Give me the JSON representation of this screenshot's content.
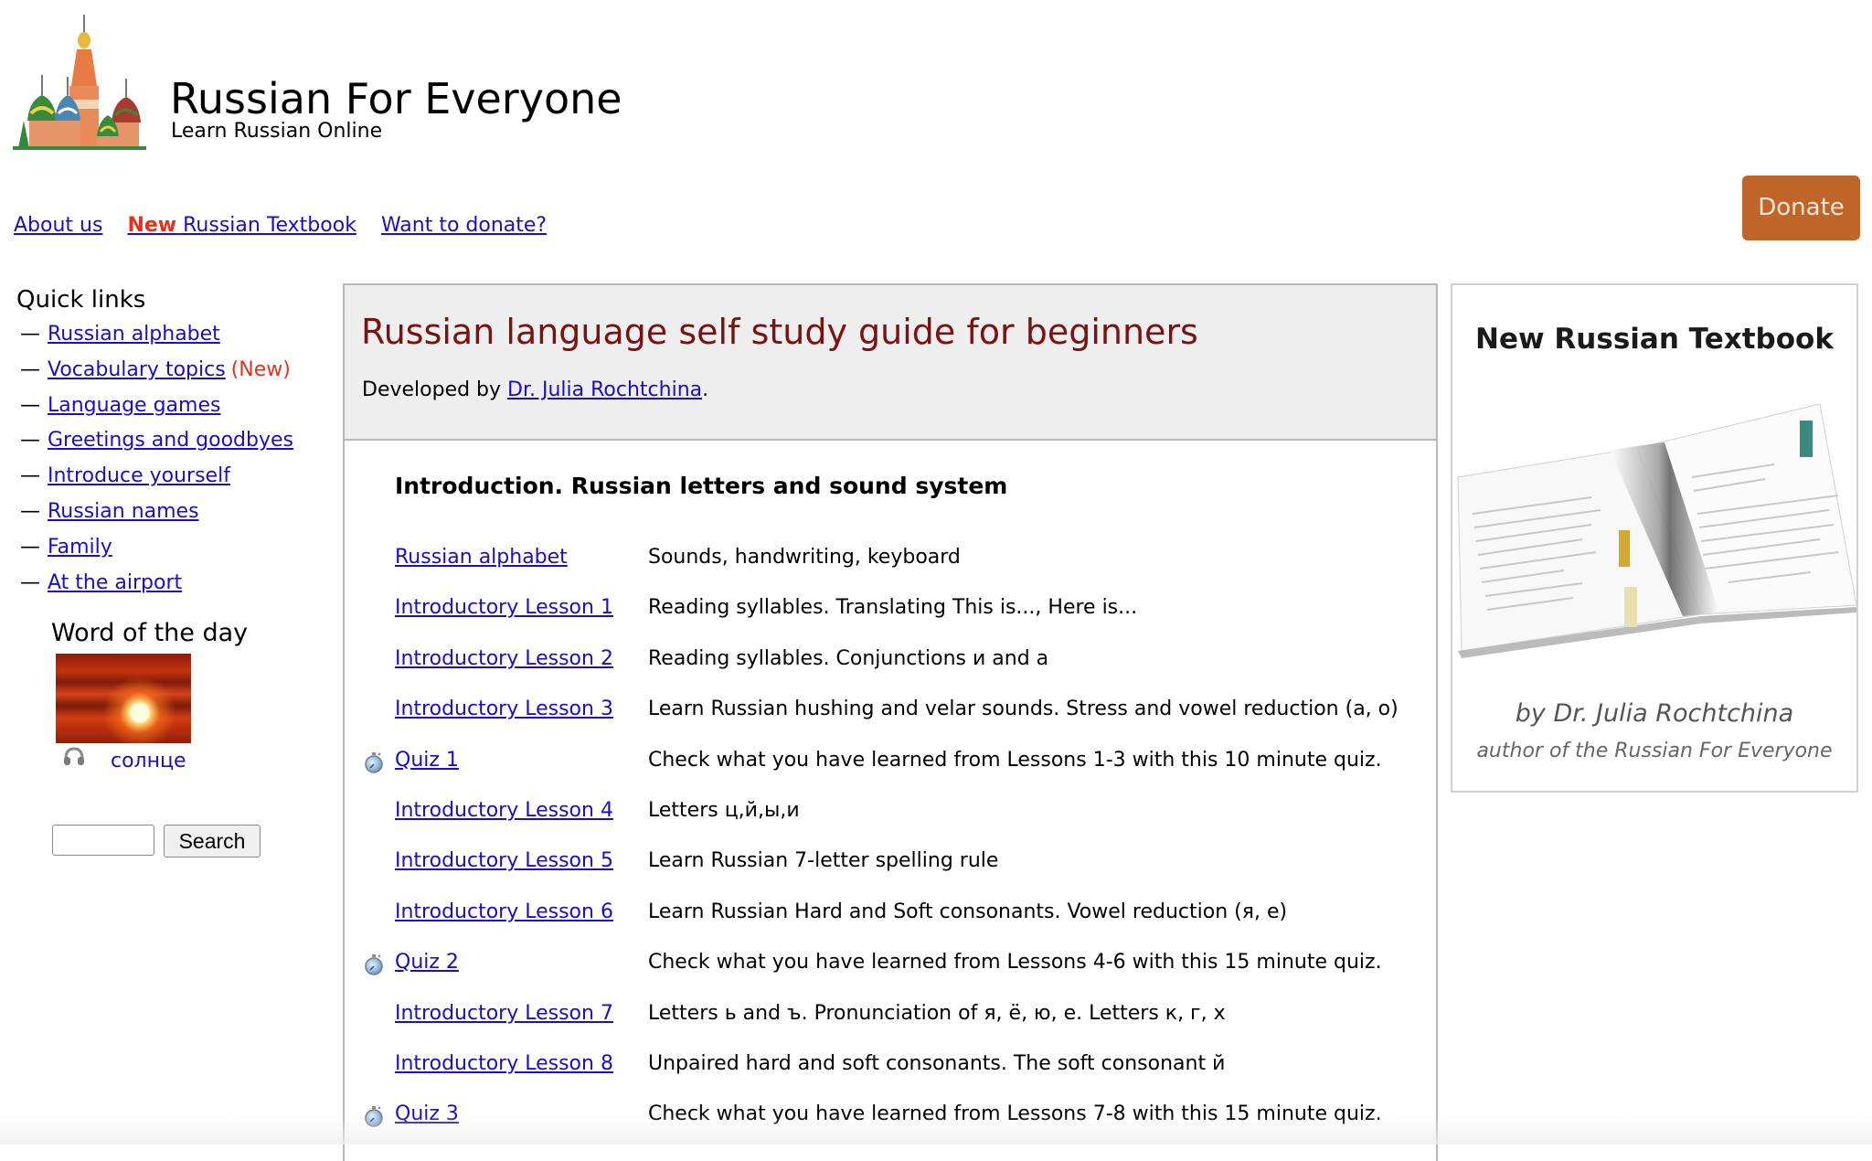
{
  "header": {
    "site_title": "Russian For Everyone",
    "site_subtitle": "Learn Russian Online",
    "logo_icon": "cathedral-logo-icon"
  },
  "nav": {
    "about": "About us",
    "textbook_new": "New",
    "textbook": " Russian Textbook",
    "donate_link": "Want to donate?",
    "donate_button": "Donate",
    "donate_color": "#c0652a",
    "new_color": "#e8301c"
  },
  "sidebar": {
    "quick_links_title": "Quick links",
    "dash": "—",
    "quick_links": [
      {
        "label": "Russian alphabet",
        "badge": ""
      },
      {
        "label": "Vocabulary topics",
        "badge": "(New)"
      },
      {
        "label": "Language games",
        "badge": ""
      },
      {
        "label": "Greetings and goodbyes",
        "badge": ""
      },
      {
        "label": "Introduce yourself",
        "badge": ""
      },
      {
        "label": "Russian names",
        "badge": ""
      },
      {
        "label": "Family",
        "badge": ""
      },
      {
        "label": "At the airport",
        "badge": ""
      }
    ],
    "word_of_day_title": "Word of the day",
    "word_of_day": "солнце",
    "word_image_icon": "sunset-image",
    "audio_icon": "headphones-icon",
    "search_value": "",
    "search_button": "Search"
  },
  "main": {
    "title": "Russian language self study guide for beginners",
    "title_color": "#7b1212",
    "developed_prefix": "Developed by ",
    "developer": "Dr. Julia Rochtchina",
    "developed_suffix": ".",
    "section_title": "Introduction. Russian letters and sound system",
    "rows": [
      {
        "link": "Russian alphabet",
        "desc": "Sounds, handwriting, keyboard",
        "quiz": false
      },
      {
        "link": "Introductory Lesson 1",
        "desc": "Reading syllables. Translating This is..., Here is...",
        "quiz": false
      },
      {
        "link": "Introductory Lesson 2",
        "desc": "Reading syllables. Conjunctions и and а",
        "quiz": false
      },
      {
        "link": "Introductory Lesson 3",
        "desc": "Learn Russian hushing and velar sounds. Stress and vowel reduction (а, о)",
        "quiz": false
      },
      {
        "link": "Quiz 1",
        "desc": "Check what you have learned from Lessons 1-3 with this 10 minute quiz.",
        "quiz": true
      },
      {
        "link": "Introductory Lesson 4",
        "desc": "Letters ц,й,ы,и",
        "quiz": false
      },
      {
        "link": "Introductory Lesson 5",
        "desc": "Learn Russian 7-letter spelling rule",
        "quiz": false
      },
      {
        "link": "Introductory Lesson 6",
        "desc": "Learn Russian Hard and Soft consonants. Vowel reduction (я, е)",
        "quiz": false
      },
      {
        "link": "Quiz 2",
        "desc": "Check what you have learned from Lessons 4-6 with this 15 minute quiz.",
        "quiz": true
      },
      {
        "link": "Introductory Lesson 7",
        "desc": "Letters ь and ъ. Pronunciation of я, ё, ю, е. Letters к, г, х",
        "quiz": false
      },
      {
        "link": "Introductory Lesson 8",
        "desc": "Unpaired hard and soft consonants. The soft consonant й",
        "quiz": false
      },
      {
        "link": "Quiz 3",
        "desc": "Check what you have learned from Lessons 7-8 with this 15 minute quiz.",
        "quiz": true
      }
    ]
  },
  "textbook_ad": {
    "title": "New Russian Textbook",
    "byline": "by Dr. Julia Rochtchina",
    "author_note": "author of the Russian For Everyone",
    "image_icon": "open-book-image"
  }
}
